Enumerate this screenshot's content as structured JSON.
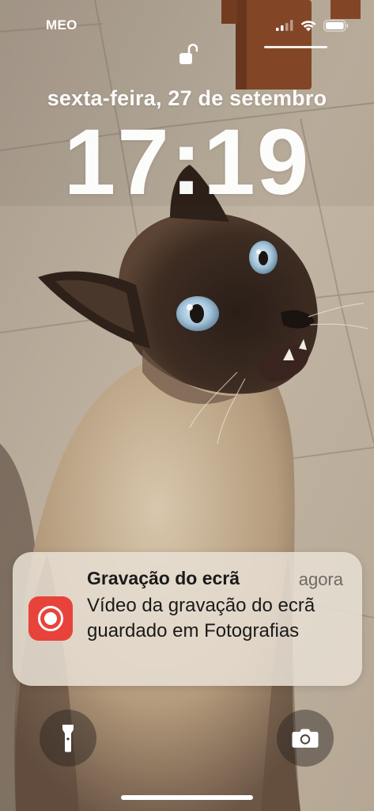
{
  "status_bar": {
    "carrier": "MEO",
    "icons": [
      "cellular-signal-icon",
      "wifi-icon",
      "battery-icon"
    ]
  },
  "lock_screen": {
    "lock_icon": "unlocked-padlock-icon",
    "date": "sexta-feira, 27 de setembro",
    "time": "17:19"
  },
  "notification": {
    "app_icon": "screen-recording-icon",
    "app_icon_color": "#e8433a",
    "title": "Gravação do ecrã",
    "timestamp": "agora",
    "body": "Vídeo da gravação do ecrã guardado em Fotografias"
  },
  "quick_actions": {
    "left": "flashlight-icon",
    "right": "camera-icon"
  },
  "wallpaper": {
    "subject": "siamese-cat-photo"
  }
}
